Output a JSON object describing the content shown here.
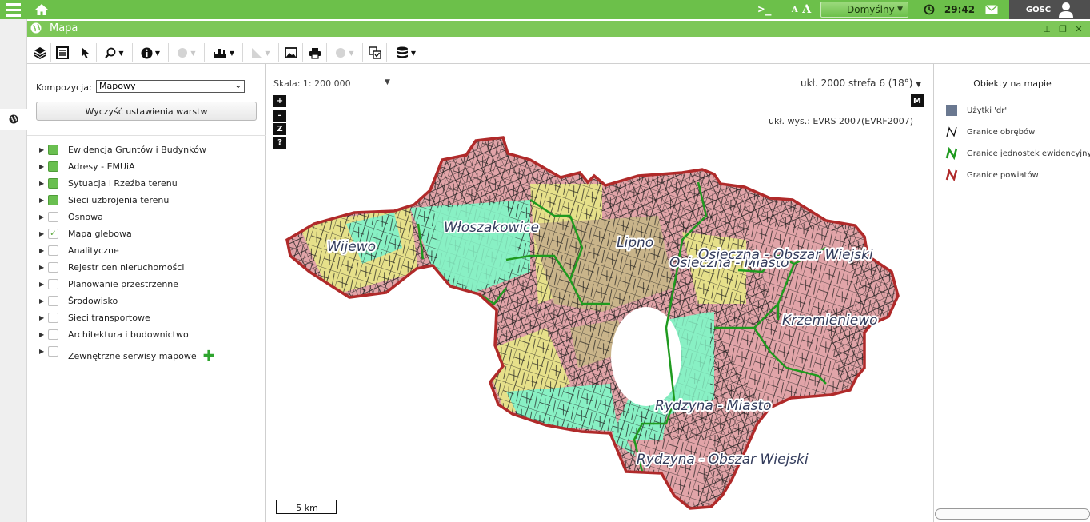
{
  "topbar": {
    "profile_label": "Domyślny",
    "time": "29:42",
    "user_label": "GOSC",
    "font_size_label": "A A",
    "terminal_glyph": ">_"
  },
  "window": {
    "title": "Mapa"
  },
  "left_panel": {
    "composition_label": "Kompozycja:",
    "composition_value": "Mapowy",
    "clear_button": "Wyczyść ustawienia warstw",
    "layers": [
      {
        "label": "Ewidencja Gruntów i Budynków",
        "state": "on"
      },
      {
        "label": "Adresy - EMUiA",
        "state": "on"
      },
      {
        "label": "Sytuacja i Rzeźba terenu",
        "state": "on"
      },
      {
        "label": "Sieci uzbrojenia terenu",
        "state": "on"
      },
      {
        "label": "Osnowa",
        "state": "off"
      },
      {
        "label": "Mapa glebowa",
        "state": "checked"
      },
      {
        "label": "Analityczne",
        "state": "off"
      },
      {
        "label": "Rejestr cen nieruchomości",
        "state": "off"
      },
      {
        "label": "Planowanie przestrzenne",
        "state": "off"
      },
      {
        "label": "Środowisko",
        "state": "off"
      },
      {
        "label": "Sieci transportowe",
        "state": "off"
      },
      {
        "label": "Architektura i budownictwo",
        "state": "off"
      },
      {
        "label": "Zewnętrzne serwisy mapowe",
        "state": "off"
      }
    ]
  },
  "map": {
    "scale_label": "Skala: 1: 200 000",
    "crs_label": "ukł. 2000 strefa 6 (18°)",
    "height_system": "ukł. wys.: EVRS 2007(EVRF2007)",
    "m_button": "M",
    "zoom_in": "+",
    "zoom_out": "–",
    "zoom_z": "Z",
    "help": "?",
    "scalebar_label": "5 km",
    "place_labels": [
      "Wijewo",
      "Włoszakowice",
      "Lipno",
      "Osieczna - Miasto",
      "Osieczna - Obszar Wiejski",
      "Krzemieniewo",
      "Rydzyna - Miasto",
      "Rydzyna - Obszar Wiejski"
    ],
    "colors": {
      "boundary_county": "#b02a2a",
      "boundary_unit": "#1f9a1f",
      "fill_a": "#88f0c4",
      "fill_b": "#e1a4a8",
      "fill_c": "#e6e08a",
      "fill_d": "#c9b48a"
    }
  },
  "legend": {
    "title": "Obiekty na mapie",
    "items": [
      {
        "label": "Użytki 'dr'",
        "icon": "square-swatch-icon",
        "color": "#6a7890"
      },
      {
        "label": "Granice obrębów",
        "icon": "black-line-icon",
        "color": "#111111"
      },
      {
        "label": "Granice jednostek ewidencyjnych",
        "icon": "green-line-icon",
        "color": "#1f9a1f"
      },
      {
        "label": "Granice powiatów",
        "icon": "red-line-icon",
        "color": "#b02a2a"
      }
    ]
  }
}
